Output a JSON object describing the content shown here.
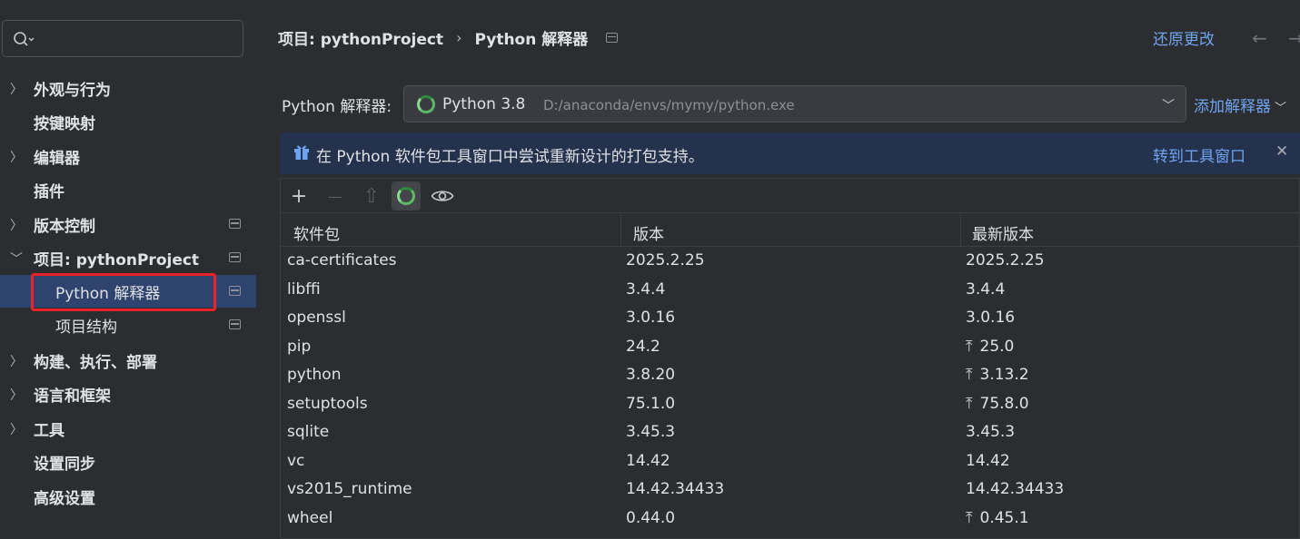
{
  "sidebar": {
    "search_placeholder": "",
    "items": [
      {
        "label": "外观与行为",
        "expandable": true,
        "pinned": false
      },
      {
        "label": "按键映射",
        "expandable": false,
        "pinned": false
      },
      {
        "label": "编辑器",
        "expandable": true,
        "pinned": false
      },
      {
        "label": "插件",
        "expandable": false,
        "pinned": false
      },
      {
        "label": "版本控制",
        "expandable": true,
        "pinned": true
      },
      {
        "label": "项目: pythonProject",
        "expandable": true,
        "expanded": true,
        "pinned": true
      },
      {
        "label": "Python 解释器",
        "sub": true,
        "selected": true,
        "pinned": true
      },
      {
        "label": "项目结构",
        "sub": true,
        "pinned": true
      },
      {
        "label": "构建、执行、部署",
        "expandable": true,
        "pinned": false
      },
      {
        "label": "语言和框架",
        "expandable": true,
        "pinned": false
      },
      {
        "label": "工具",
        "expandable": true,
        "pinned": false
      },
      {
        "label": "设置同步",
        "expandable": false,
        "pinned": false
      },
      {
        "label": "高级设置",
        "expandable": false,
        "pinned": false
      }
    ]
  },
  "header": {
    "breadcrumb_project": "项目: pythonProject",
    "breadcrumb_sep": "›",
    "breadcrumb_page": "Python 解释器",
    "restore_label": "还原更改",
    "back_icon": "←",
    "forward_icon": "→"
  },
  "interpreter": {
    "label": "Python 解释器:",
    "name": "Python 3.8",
    "path": "D:/anaconda/envs/mymy/python.exe",
    "add_label": "添加解释器"
  },
  "banner": {
    "text": "在 Python 软件包工具窗口中尝试重新设计的打包支持。",
    "link": "转到工具窗口",
    "close": "✕"
  },
  "toolbar": {
    "add": "+",
    "remove": "—",
    "upgrade": "⇧",
    "show": "eye-icon"
  },
  "table": {
    "columns": [
      "软件包",
      "版本",
      "最新版本"
    ],
    "rows": [
      {
        "package": "ca-certificates",
        "version": "2025.2.25",
        "latest": "2025.2.25",
        "upgradable": false
      },
      {
        "package": "libffi",
        "version": "3.4.4",
        "latest": "3.4.4",
        "upgradable": false
      },
      {
        "package": "openssl",
        "version": "3.0.16",
        "latest": "3.0.16",
        "upgradable": false
      },
      {
        "package": "pip",
        "version": "24.2",
        "latest": "25.0",
        "upgradable": true
      },
      {
        "package": "python",
        "version": "3.8.20",
        "latest": "3.13.2",
        "upgradable": true
      },
      {
        "package": "setuptools",
        "version": "75.1.0",
        "latest": "75.8.0",
        "upgradable": true
      },
      {
        "package": "sqlite",
        "version": "3.45.3",
        "latest": "3.45.3",
        "upgradable": false
      },
      {
        "package": "vc",
        "version": "14.42",
        "latest": "14.42",
        "upgradable": false
      },
      {
        "package": "vs2015_runtime",
        "version": "14.42.34433",
        "latest": "14.42.34433",
        "upgradable": false
      },
      {
        "package": "wheel",
        "version": "0.44.0",
        "latest": "0.45.1",
        "upgradable": true
      }
    ]
  },
  "colors": {
    "background": "#2b2d30",
    "accent_link": "#6ea4f0",
    "selected_row": "#2e436e",
    "banner_bg": "#25324d",
    "highlight_border": "#e8232a"
  }
}
